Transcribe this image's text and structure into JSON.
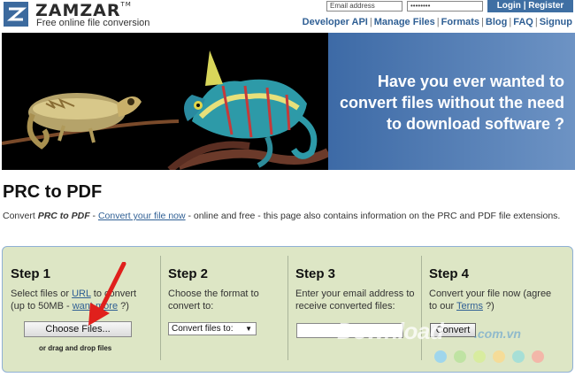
{
  "header": {
    "logo_name": "ZAMZAR",
    "logo_tm": "TM",
    "tagline": "Free online file conversion",
    "email_placeholder": "Email address",
    "password_mask": "••••••••",
    "login_label": "Login | Register",
    "nav": [
      "Developer API",
      "Manage Files",
      "Formats",
      "Blog",
      "FAQ",
      "Signup"
    ]
  },
  "banner": {
    "line1": "Have you ever wanted to",
    "line2": "convert files without the need",
    "line3": "to download software ?"
  },
  "page": {
    "title": "PRC to PDF",
    "intro_pre": "Convert ",
    "intro_bold": "PRC to PDF",
    "intro_dash": " - ",
    "intro_link": "Convert your file now",
    "intro_post": " - online and free - this page also contains information on the PRC and PDF file extensions."
  },
  "steps": [
    {
      "title": "Step 1",
      "desc_pre": "Select files or ",
      "desc_link1": "URL",
      "desc_mid": " to convert",
      "desc_line2_pre": "(up to 50MB - ",
      "desc_link2": "want more",
      "desc_line2_post": " ?)",
      "button": "Choose Files...",
      "hint": "or drag and drop files"
    },
    {
      "title": "Step 2",
      "desc_line1": "Choose the format to",
      "desc_line2": "convert to:",
      "select_value": "Convert files to:"
    },
    {
      "title": "Step 3",
      "desc_line1": "Enter your email address to",
      "desc_line2": "receive converted files:"
    },
    {
      "title": "Step 4",
      "desc_line1": "Convert your file now (agree",
      "desc_line2_pre": "to our ",
      "desc_link": "Terms",
      "desc_line2_post": " ?)",
      "button": "Convert"
    }
  ],
  "watermark": {
    "text": "Download",
    "domain": ".com.vn"
  },
  "colors": {
    "brand_blue": "#3f6fa3",
    "steps_bg": "#dde6c5",
    "arrow_red": "#e0201c"
  }
}
